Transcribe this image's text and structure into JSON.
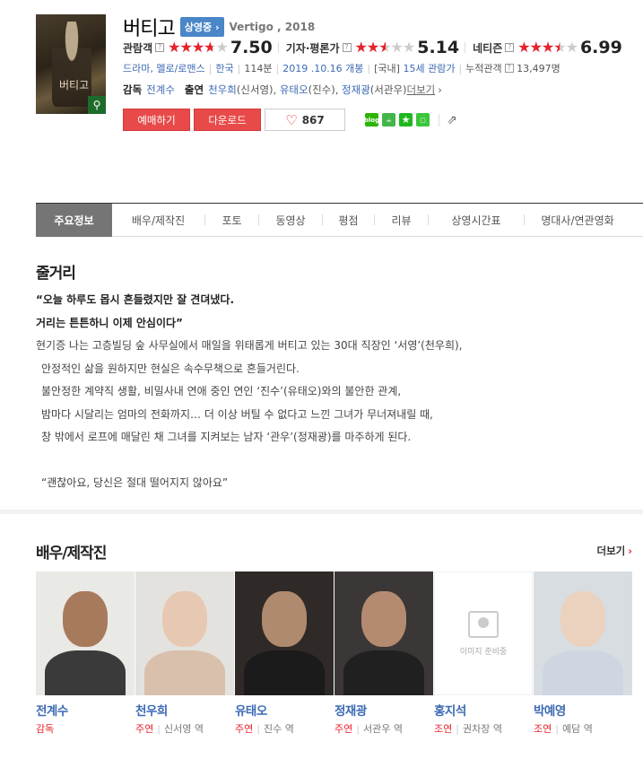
{
  "movie": {
    "title": "버티고",
    "status": "상영중",
    "status_arrow": "›",
    "original_title": "Vertigo , 2018",
    "poster_title": "버티고",
    "poster_zoom_icon": "magnifier-icon"
  },
  "ratings": [
    {
      "label": "관람객",
      "score": "7.50",
      "value": 7.5,
      "help": "?"
    },
    {
      "label": "기자·평론가",
      "score": "5.14",
      "value": 5.14,
      "help": "?"
    },
    {
      "label": "네티즌",
      "score": "6.99",
      "value": 6.99,
      "help": "?"
    }
  ],
  "rating_max": 10,
  "info": {
    "genres": "드라마, 멜로/로맨스",
    "country": "한국",
    "runtime": "114분",
    "release": "2019 .10.16 개봉",
    "rating_region": "[국내]",
    "rating": "15세 관람가",
    "audience_label": "누적관객",
    "audience_help": "?",
    "audience": "13,497명"
  },
  "credits": {
    "director_label": "감독",
    "director": "전계수",
    "cast_label": "출연",
    "cast": [
      {
        "name": "천우희",
        "role": "(신서영)"
      },
      {
        "name": "유태오",
        "role": "(진수)"
      },
      {
        "name": "정재광",
        "role": "(서관우)"
      }
    ],
    "more": "더보기",
    "more_arrow": "›"
  },
  "actions": {
    "reserve": "예매하기",
    "download": "다운로드",
    "like_count": "867",
    "like_icon": "heart-icon",
    "share": [
      {
        "name": "blog",
        "text": "blog"
      },
      {
        "name": "cafe",
        "text": "☕"
      },
      {
        "name": "star",
        "text": "★"
      },
      {
        "name": "band",
        "text": "▢"
      }
    ],
    "share_icon": "⇗"
  },
  "tabs": [
    "주요정보",
    "배우/제작진",
    "포토",
    "동영상",
    "평점",
    "리뷰",
    "상영시간표",
    "명대사/연관영화"
  ],
  "synopsis": {
    "heading": "줄거리",
    "lines": [
      {
        "text": "“오늘 하루도 몹시 흔들렸지만 잘 견뎌냈다.",
        "style": "bold"
      },
      {
        "text": "거리는 튼튼하니 이제 안심이다”",
        "style": "bold"
      },
      {
        "text": "현기증 나는 고층빌딩 숲 사무실에서 매일을 위태롭게 버티고 있는 30대 직장인 ‘서영’(천우희),",
        "style": ""
      },
      {
        "text": "안정적인 삶을 원하지만 현실은 속수무책으로 흔들거린다.",
        "style": "ind"
      },
      {
        "text": "불안정한 계약직 생활, 비밀사내 연애 중인 연인 ‘진수’(유태오)와의 불안한 관계,",
        "style": "ind"
      },
      {
        "text": "밤마다 시달리는 엄마의 전화까지… 더 이상 버틸 수 없다고 느낀 그녀가 무너져내릴 때,",
        "style": "ind"
      },
      {
        "text": "창 밖에서 로프에 매달린 채 그녀를 지켜보는 남자 ‘관우’(정재광)를 마주하게 된다.",
        "style": "ind"
      },
      {
        "text": "",
        "style": "gap"
      },
      {
        "text": "“괜찮아요, 당신은 절대 떨어지지 않아요”",
        "style": "ind"
      }
    ]
  },
  "cast_section": {
    "heading": "배우/제작진",
    "more": "더보기",
    "more_arrow": "›",
    "noimage_text": "이미지 준비중",
    "people": [
      {
        "name": "전계수",
        "type": "감독",
        "role": ""
      },
      {
        "name": "천우희",
        "type": "주연",
        "role": "신서영 역"
      },
      {
        "name": "유태오",
        "type": "주연",
        "role": "진수 역"
      },
      {
        "name": "정재광",
        "type": "주연",
        "role": "서관우 역"
      },
      {
        "name": "홍지석",
        "type": "조연",
        "role": "권차장 역"
      },
      {
        "name": "박예영",
        "type": "조연",
        "role": "예담 역"
      }
    ]
  },
  "colors": {
    "accent_red": "#e8222d",
    "link_blue": "#3c6ab4",
    "badge_blue": "#4a86c8",
    "tab_active": "#757575"
  }
}
